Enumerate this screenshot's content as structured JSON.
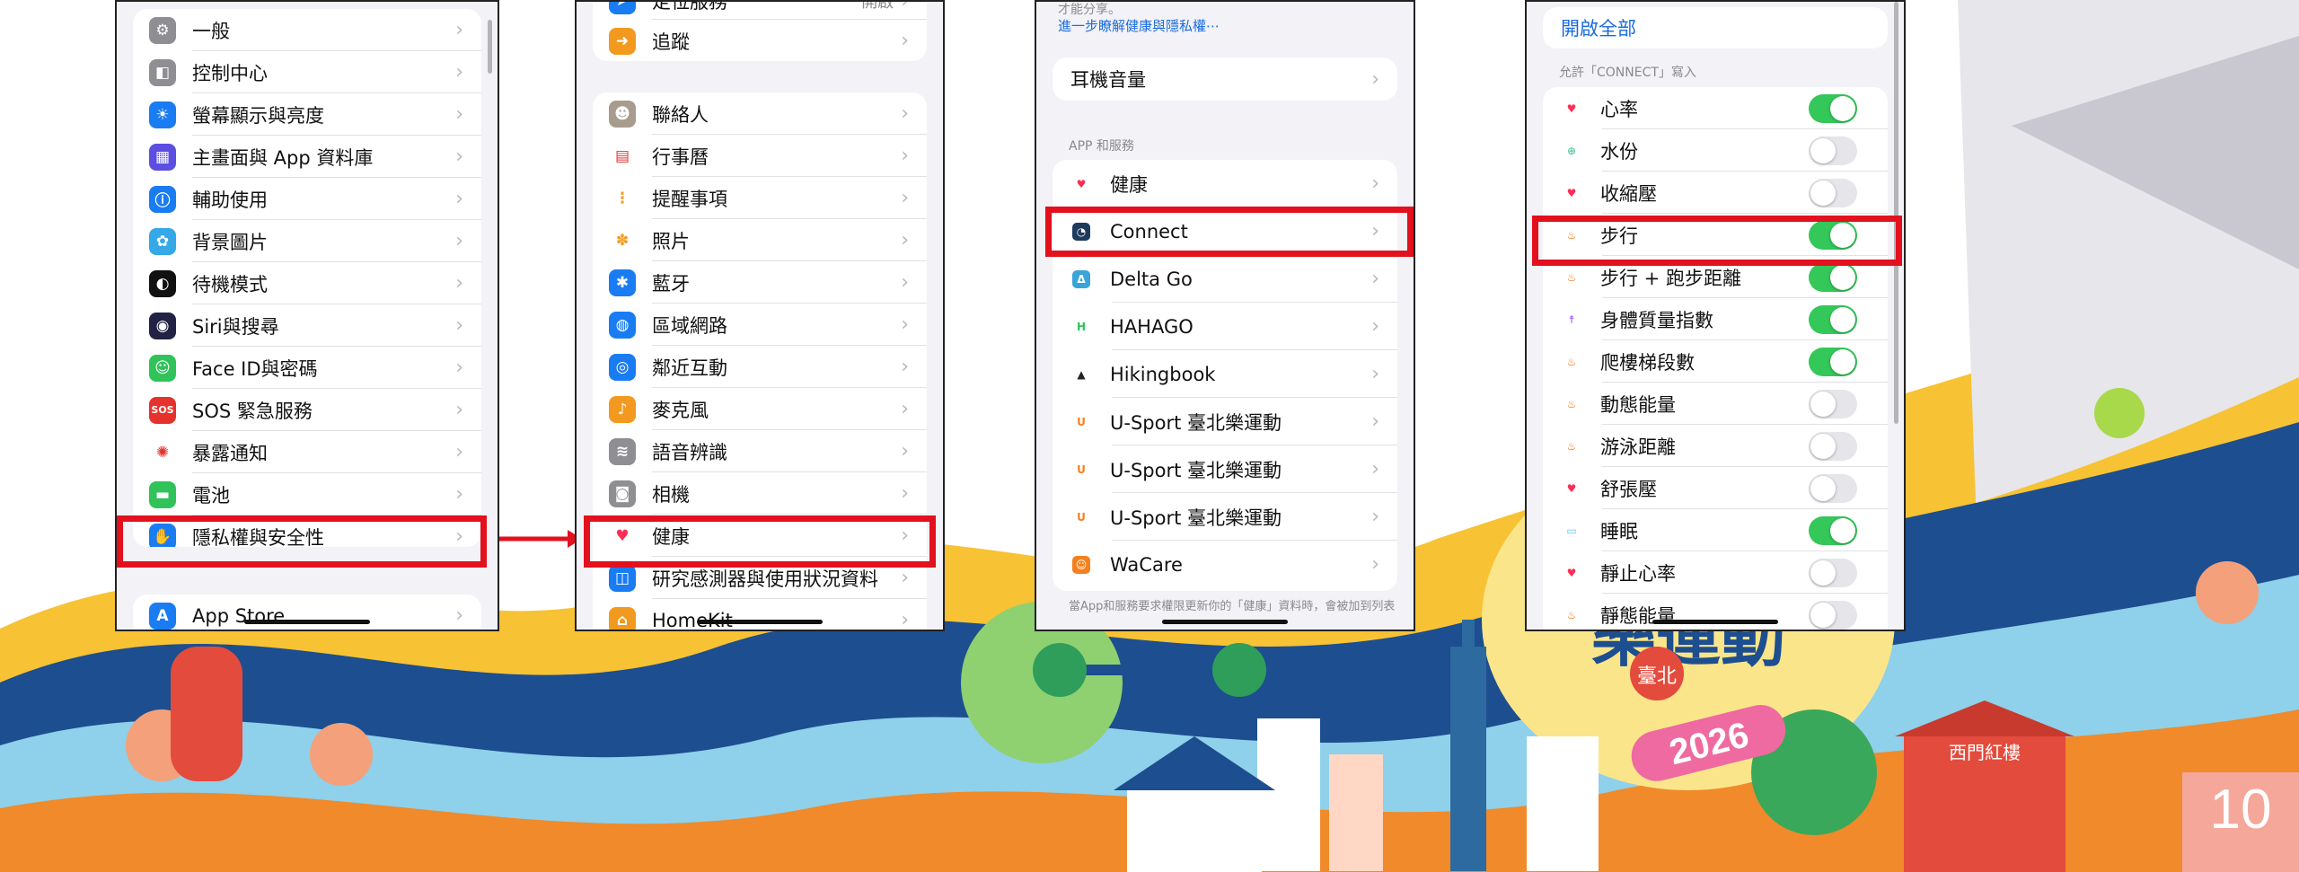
{
  "colors": {
    "highlight": "#e3101d",
    "toggle_on": "#34c759",
    "toggle_off": "#e5e5ea",
    "link": "#1a6cde",
    "page_badge": "#f5a89a"
  },
  "phone1": {
    "items": [
      {
        "label": "一般",
        "icon": "gear-icon",
        "color": "#8e8e93",
        "glyph": "⚙"
      },
      {
        "label": "控制中心",
        "icon": "control-center-icon",
        "color": "#8e8e93",
        "glyph": "◧"
      },
      {
        "label": "螢幕顯示與亮度",
        "icon": "brightness-icon",
        "color": "#1a7cf2",
        "glyph": "☀"
      },
      {
        "label": "主畫面與 App 資料庫",
        "icon": "home-screen-icon",
        "color": "#5b4ee0",
        "glyph": "▦"
      },
      {
        "label": "輔助使用",
        "icon": "accessibility-icon",
        "color": "#1a7cf2",
        "glyph": "ⓘ"
      },
      {
        "label": "背景圖片",
        "icon": "wallpaper-icon",
        "color": "#35a8e8",
        "glyph": "✿"
      },
      {
        "label": "待機模式",
        "icon": "standby-icon",
        "color": "#111111",
        "glyph": "◐"
      },
      {
        "label": "Siri與搜尋",
        "icon": "siri-icon",
        "color": "#222244",
        "glyph": "◉"
      },
      {
        "label": "Face ID與密碼",
        "icon": "face-id-icon",
        "color": "#30c35a",
        "glyph": "☺"
      },
      {
        "label": "SOS 緊急服務",
        "icon": "sos-icon",
        "color": "#e5322d",
        "glyph": "SOS"
      },
      {
        "label": "暴露通知",
        "icon": "exposure-notification-icon",
        "color": "#ffffff",
        "glyph": "✺"
      },
      {
        "label": "電池",
        "icon": "battery-icon",
        "color": "#30c35a",
        "glyph": "▬"
      },
      {
        "label": "隱私權與安全性",
        "icon": "privacy-hand-icon",
        "color": "#1a7cf2",
        "glyph": "✋"
      }
    ],
    "store": {
      "label": "App Store",
      "icon": "app-store-icon",
      "color": "#1a7cf2",
      "glyph": "A"
    }
  },
  "phone2": {
    "top_items": [
      {
        "label": "定位服務",
        "value": "開啟"
      },
      {
        "label": "追蹤",
        "icon": "tracking-icon",
        "color": "#f29a1f",
        "glyph": "➜"
      }
    ],
    "items": [
      {
        "label": "聯絡人",
        "icon": "contacts-icon",
        "color": "#a89c8e",
        "glyph": "☻"
      },
      {
        "label": "行事曆",
        "icon": "calendar-icon",
        "color": "#ffffff",
        "glyph": "▤"
      },
      {
        "label": "提醒事項",
        "icon": "reminders-icon",
        "color": "#ffffff",
        "glyph": "⋮"
      },
      {
        "label": "照片",
        "icon": "photos-icon",
        "color": "#ffffff",
        "glyph": "✽"
      },
      {
        "label": "藍牙",
        "icon": "bluetooth-icon",
        "color": "#1a7cf2",
        "glyph": "✱"
      },
      {
        "label": "區域網路",
        "icon": "local-network-icon",
        "color": "#1a7cf2",
        "glyph": "◍"
      },
      {
        "label": "鄰近互動",
        "icon": "nearby-interaction-icon",
        "color": "#1a7cf2",
        "glyph": "◎"
      },
      {
        "label": "麥克風",
        "icon": "microphone-icon",
        "color": "#f29a1f",
        "glyph": "♪"
      },
      {
        "label": "語音辨識",
        "icon": "speech-recognition-icon",
        "color": "#8e8e93",
        "glyph": "≋"
      },
      {
        "label": "相機",
        "icon": "camera-icon",
        "color": "#8e8e93",
        "glyph": "◙"
      },
      {
        "label": "健康",
        "icon": "health-heart-icon",
        "color": "#ffffff",
        "glyph": "♥"
      },
      {
        "label": "研究感測器與使用狀況資料",
        "icon": "research-sensor-icon",
        "color": "#1a7cf2",
        "glyph": "◫"
      },
      {
        "label": "HomeKit",
        "icon": "homekit-icon",
        "color": "#f29a1f",
        "glyph": "⌂"
      }
    ]
  },
  "phone3": {
    "top_note": "才能分享。",
    "top_link": "進一步瞭解健康與隱私權⋯",
    "headphone_label": "耳機音量",
    "section_header": "APP 和服務",
    "apps": [
      {
        "label": "健康",
        "icon": "health-heart-icon",
        "color": "#ffffff",
        "glyph": "♥"
      },
      {
        "label": "Connect",
        "icon": "garmin-connect-icon",
        "color": "#1d3b5c",
        "glyph": "◔"
      },
      {
        "label": "Delta Go",
        "icon": "delta-go-icon",
        "color": "#3aa4d9",
        "glyph": "Δ"
      },
      {
        "label": "HAHAGO",
        "icon": "hahago-icon",
        "color": "#ffffff",
        "glyph": "H"
      },
      {
        "label": "Hikingbook",
        "icon": "hikingbook-icon",
        "color": "#ffffff",
        "glyph": "▲"
      },
      {
        "label": "U-Sport 臺北樂運動",
        "icon": "usport-icon",
        "color": "#ffffff",
        "glyph": "U"
      },
      {
        "label": "U-Sport 臺北樂運動",
        "icon": "usport-icon",
        "color": "#ffffff",
        "glyph": "U"
      },
      {
        "label": "U-Sport 臺北樂運動",
        "icon": "usport-icon",
        "color": "#ffffff",
        "glyph": "U"
      },
      {
        "label": "WaCare",
        "icon": "wacare-icon",
        "color": "#f5801f",
        "glyph": "☺"
      }
    ],
    "footer_note": "當App和服務要求權限更新你的「健康」資料時，會被加到列表"
  },
  "phone4": {
    "enable_all": "開啟全部",
    "section_header": "允許「CONNECT」寫入",
    "items": [
      {
        "label": "心率",
        "icon": "heart-icon",
        "color": "#ff2d55",
        "glyph": "♥",
        "on": true
      },
      {
        "label": "水份",
        "icon": "water-icon",
        "color": "#5ac8a8",
        "glyph": "⊕",
        "on": false
      },
      {
        "label": "收縮壓",
        "icon": "heart-icon",
        "color": "#ff2d55",
        "glyph": "♥",
        "on": false
      },
      {
        "label": "步行",
        "icon": "flame-icon",
        "color": "#ff6a00",
        "glyph": "♨",
        "on": true
      },
      {
        "label": "步行 + 跑步距離",
        "icon": "flame-icon",
        "color": "#ff6a00",
        "glyph": "♨",
        "on": true
      },
      {
        "label": "身體質量指數",
        "icon": "body-figure-icon",
        "color": "#a855f7",
        "glyph": "☨",
        "on": true
      },
      {
        "label": "爬樓梯段數",
        "icon": "flame-icon",
        "color": "#ff6a00",
        "glyph": "♨",
        "on": true
      },
      {
        "label": "動態能量",
        "icon": "flame-icon",
        "color": "#ff6a00",
        "glyph": "♨",
        "on": false
      },
      {
        "label": "游泳距離",
        "icon": "flame-icon",
        "color": "#ff6a00",
        "glyph": "♨",
        "on": false
      },
      {
        "label": "舒張壓",
        "icon": "heart-icon",
        "color": "#ff2d55",
        "glyph": "♥",
        "on": false
      },
      {
        "label": "睡眠",
        "icon": "bed-icon",
        "color": "#5ac8fa",
        "glyph": "▭",
        "on": true
      },
      {
        "label": "靜止心率",
        "icon": "heart-icon",
        "color": "#ff2d55",
        "glyph": "♥",
        "on": false
      },
      {
        "label": "靜態能量",
        "icon": "flame-icon",
        "color": "#ff6a00",
        "glyph": "♨",
        "on": false
      }
    ]
  },
  "banner": {
    "brand_line1": "樂運動",
    "brand_badge": "臺北",
    "year": "2026",
    "landmark_sign": "西門紅樓"
  },
  "page_number": "10"
}
